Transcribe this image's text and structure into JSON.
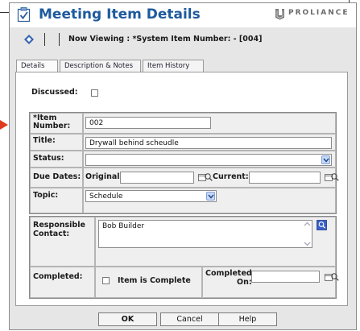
{
  "window": {
    "title": "Meeting Item Details",
    "logo_text": "PROLIANCE"
  },
  "nav": {
    "now_viewing": "Now Viewing : *System Item Number: - [004]"
  },
  "tabs": [
    {
      "label": "Details",
      "active": true
    },
    {
      "label": "Description & Notes",
      "active": false
    },
    {
      "label": "Item History",
      "active": false
    }
  ],
  "form": {
    "discussed_label": "Discussed:",
    "discussed_checked": false,
    "item_number_label_1": "*Item",
    "item_number_label_2": "Number:",
    "item_number_value": "002",
    "title_label": "Title:",
    "title_value": "Drywall behind scheudle",
    "status_label": "Status:",
    "status_value": "",
    "due_dates_label": "Due Dates:",
    "original_label": "Original:",
    "original_value": "",
    "current_label": "Current:",
    "current_value": "",
    "topic_label": "Topic:",
    "topic_value": "Schedule",
    "responsible_label_1": "Responsible",
    "responsible_label_2": "Contact:",
    "responsible_value": "Bob Builder",
    "completed_label": "Completed:",
    "item_complete_label": "Item is Complete",
    "item_complete_checked": false,
    "completed_on_label_1": "Completed",
    "completed_on_label_2": "On:",
    "completed_on_value": ""
  },
  "buttons": {
    "ok": "OK",
    "cancel": "Cancel",
    "help": "Help"
  },
  "colors": {
    "title": "#1e5a9e",
    "dropdown_button": "#c8d8f6",
    "arrow": "#e03a1e",
    "panel_bg": "#e6e6e6"
  }
}
